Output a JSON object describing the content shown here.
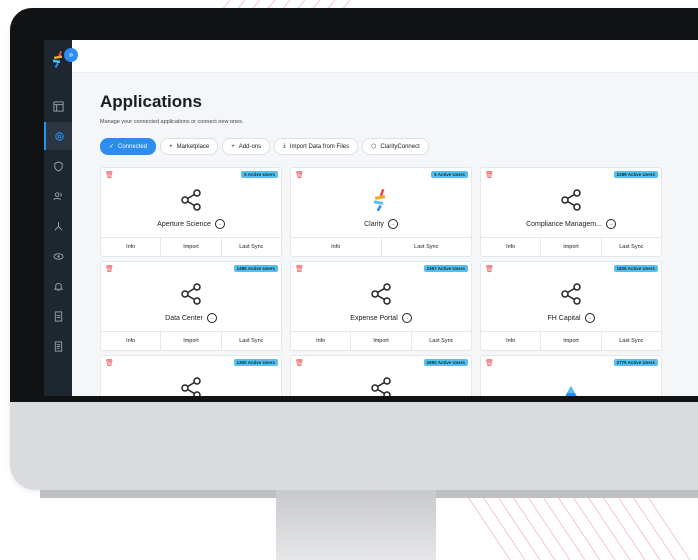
{
  "app": {
    "title": "Applications",
    "subtitle": "Manage your connected applications or connect new ones."
  },
  "tabs": [
    {
      "label": "Connected",
      "icon": "check-icon",
      "active": true
    },
    {
      "label": "Marketplace",
      "icon": "plus-icon",
      "active": false
    },
    {
      "label": "Add-ons",
      "icon": "plus-icon",
      "active": false
    },
    {
      "label": "Import Data from Files",
      "icon": "upload-icon",
      "active": false
    },
    {
      "label": "ClarityConnect",
      "icon": "cube-icon",
      "active": false
    }
  ],
  "sidebar": {
    "items": [
      {
        "icon": "layout-icon"
      },
      {
        "icon": "settings-icon",
        "active": true
      },
      {
        "icon": "shield-icon"
      },
      {
        "icon": "users-icon"
      },
      {
        "icon": "hierarchy-icon"
      },
      {
        "icon": "eye-icon"
      },
      {
        "icon": "bell-icon"
      },
      {
        "icon": "document-icon"
      },
      {
        "icon": "report-icon"
      }
    ]
  },
  "cards": [
    {
      "name": "Aperture Science",
      "badge": "0 Active Users",
      "icon": "share-icon",
      "actions": [
        "Info",
        "Import",
        "Last Sync"
      ]
    },
    {
      "name": "Clarity",
      "badge": "5 Active Users",
      "icon": "clarity-logo-icon",
      "actions": [
        "Info",
        "Last Sync"
      ]
    },
    {
      "name": "Compliance Managem...",
      "badge": "2289 Active Users",
      "icon": "share-icon",
      "actions": [
        "Info",
        "Import",
        "Last Sync"
      ]
    },
    {
      "name": "Data Center",
      "badge": "1485 Active Users",
      "icon": "share-icon",
      "actions": [
        "Info",
        "Import",
        "Last Sync"
      ]
    },
    {
      "name": "Expense Portal",
      "badge": "2367 Active Users",
      "icon": "share-icon",
      "actions": [
        "Info",
        "Import",
        "Last Sync"
      ]
    },
    {
      "name": "FH Capital",
      "badge": "1826 Active Users",
      "icon": "share-icon",
      "actions": [
        "Info",
        "Import",
        "Last Sync"
      ]
    },
    {
      "name": "",
      "badge": "1300 Active Users",
      "icon": "share-icon",
      "actions": []
    },
    {
      "name": "",
      "badge": "2650 Active Users",
      "icon": "share-icon",
      "actions": []
    },
    {
      "name": "",
      "badge": "2775 Active Users",
      "icon": "app-logo-icon",
      "actions": []
    }
  ],
  "colors": {
    "accent": "#2d8cf0",
    "badge": "#55c0ef",
    "danger": "#e5484d",
    "sidebar": "#1e2630"
  }
}
